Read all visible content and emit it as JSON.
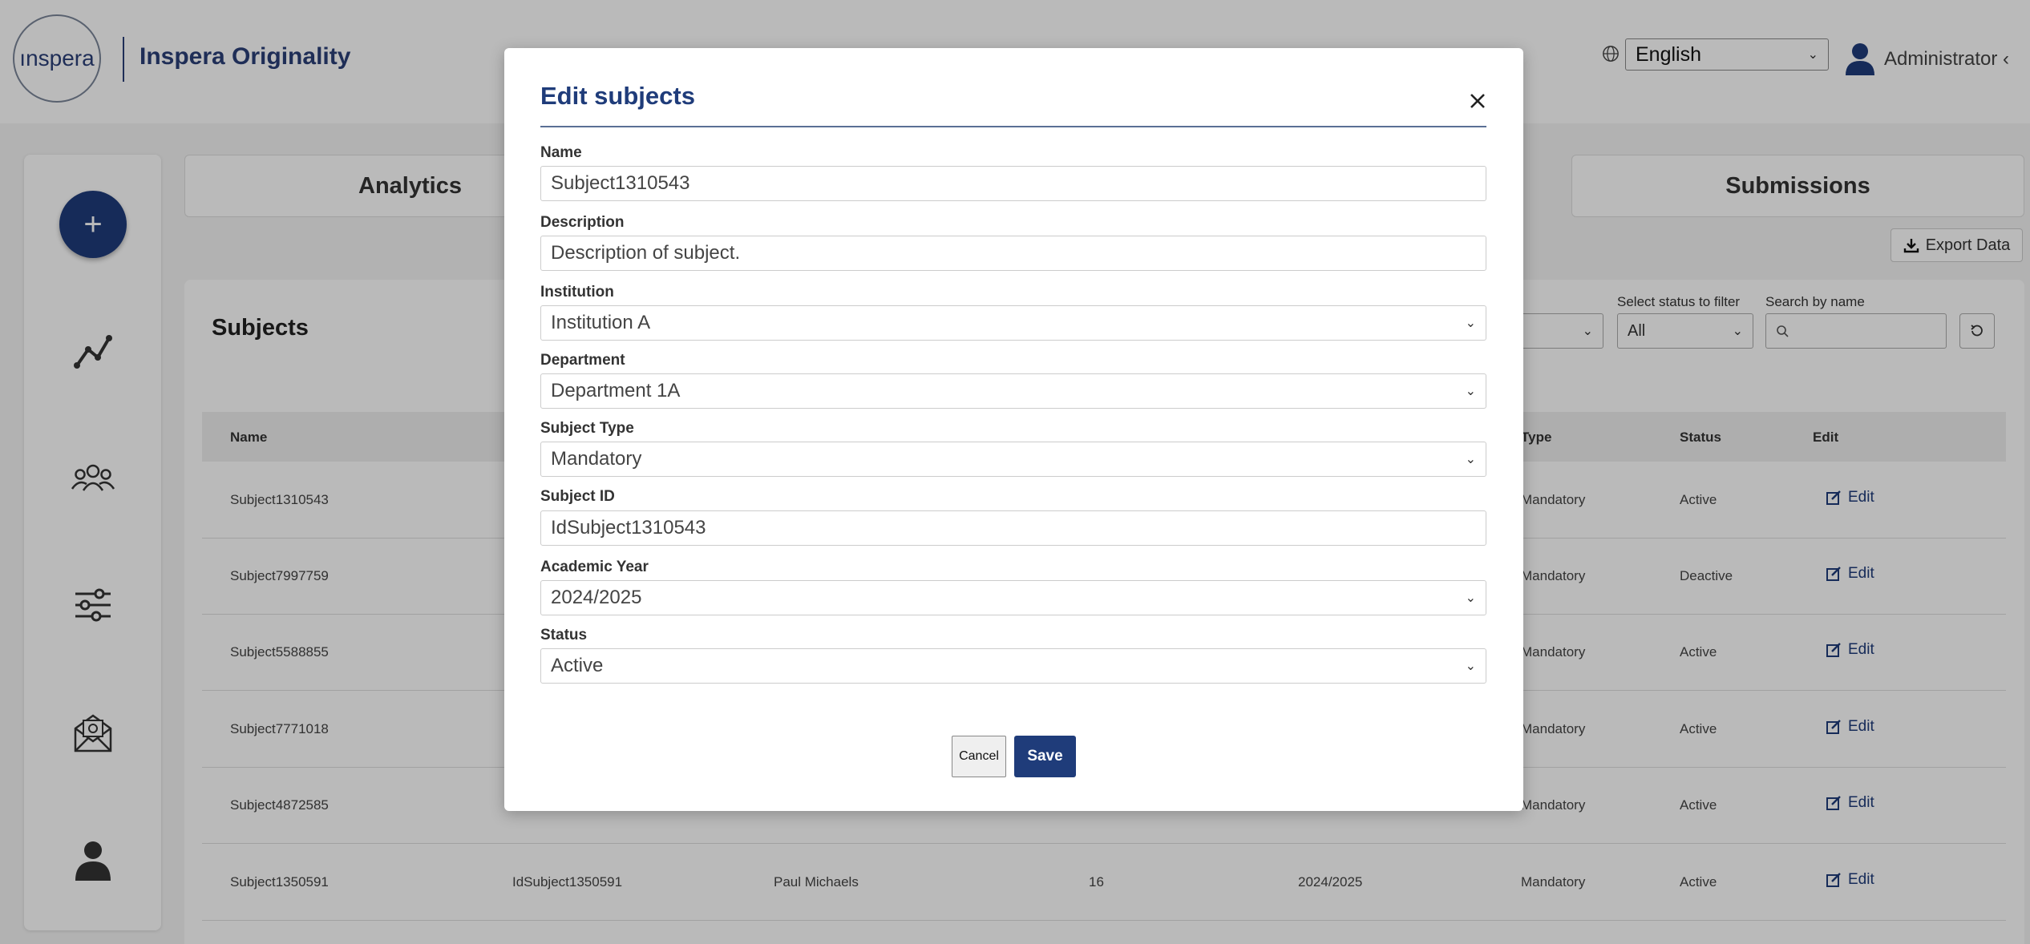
{
  "header": {
    "logo_text": "ınspera",
    "brand": "Inspera Originality",
    "language": "English",
    "user": "Administrator"
  },
  "sidebar": {
    "add_label": "+",
    "icons": [
      "analytics-icon",
      "users-icon",
      "settings-sliders-icon",
      "mail-icon",
      "profile-icon"
    ]
  },
  "tabs": {
    "analytics": "Analytics",
    "subjects": "",
    "submissions": "Submissions"
  },
  "toolbar": {
    "export_label": "Export Data"
  },
  "subjects_panel": {
    "title": "Subjects",
    "filter_status_label": "Select status to filter",
    "filter_status_value": "All",
    "search_label": "Search by name",
    "columns": [
      "Name",
      "Type",
      "Status",
      "Edit"
    ],
    "rows": [
      {
        "name": "Subject1310543",
        "type": "Mandatory",
        "status": "Active",
        "edit": "Edit"
      },
      {
        "name": "Subject7997759",
        "type": "Mandatory",
        "status": "Deactive",
        "edit": "Edit"
      },
      {
        "name": "Subject5588855",
        "type": "Mandatory",
        "status": "Active",
        "edit": "Edit"
      },
      {
        "name": "Subject7771018",
        "type": "Mandatory",
        "status": "Active",
        "edit": "Edit"
      },
      {
        "name": "Subject4872585",
        "type": "Mandatory",
        "status": "Active",
        "edit": "Edit"
      },
      {
        "name": "Subject1350591",
        "id": "IdSubject1350591",
        "teacher": "Paul Michaels",
        "count": "16",
        "year": "2024/2025",
        "type": "Mandatory",
        "status": "Active",
        "edit": "Edit"
      }
    ]
  },
  "modal": {
    "title": "Edit subjects",
    "name_label": "Name",
    "name_value": "Subject1310543",
    "description_label": "Description",
    "description_value": "Description of subject.",
    "institution_label": "Institution",
    "institution_value": "Institution A",
    "department_label": "Department",
    "department_value": "Department 1A",
    "subject_type_label": "Subject Type",
    "subject_type_value": "Mandatory",
    "subject_id_label": "Subject ID",
    "subject_id_value": "IdSubject1310543",
    "academic_year_label": "Academic Year",
    "academic_year_value": "2024/2025",
    "status_label": "Status",
    "status_value": "Active",
    "cancel_label": "Cancel",
    "save_label": "Save"
  },
  "colors": {
    "brand": "#1f3c7a",
    "overlay": "rgba(0,0,0,0.27)"
  }
}
